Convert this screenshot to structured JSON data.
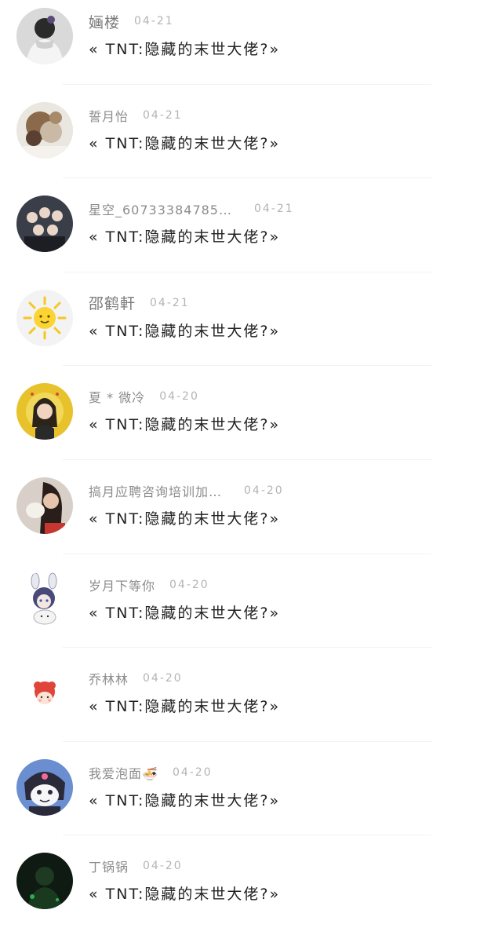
{
  "comments": [
    {
      "user": "婳楼",
      "date": "04-21",
      "text": "« TNT:隐藏的末世大佬?»",
      "avatar_icon": "user-avatar-icon"
    },
    {
      "user": "誓月怡",
      "date": "04-21",
      "text": "« TNT:隐藏的末世大佬?»",
      "avatar_icon": "user-avatar-icon"
    },
    {
      "user": "星空_60733384785…",
      "date": "04-21",
      "text": "« TNT:隐藏的末世大佬?»",
      "avatar_icon": "group-photo-avatar-icon"
    },
    {
      "user": "邵鹤軒",
      "date": "04-21",
      "text": "« TNT:隐藏的末世大佬?»",
      "avatar_icon": "sun-avatar-icon"
    },
    {
      "user": "夏 * 微冷",
      "date": "04-20",
      "text": "« TNT:隐藏的末世大佬?»",
      "avatar_icon": "user-avatar-icon"
    },
    {
      "user": "搞月应聘咨询培训加…",
      "date": "04-20",
      "text": "« TNT:隐藏的末世大佬?»",
      "avatar_icon": "user-avatar-icon"
    },
    {
      "user": "岁月下等你",
      "date": "04-20",
      "text": "« TNT:隐藏的末世大佬?»",
      "avatar_icon": "anime-bunny-avatar-icon"
    },
    {
      "user": "乔林林",
      "date": "04-20",
      "text": "« TNT:隐藏的末世大佬?»",
      "avatar_icon": "cartoon-girl-avatar-icon"
    },
    {
      "user": "我爱泡面🍜",
      "date": "04-20",
      "text": "« TNT:隐藏的末世大佬?»",
      "avatar_icon": "kuromi-avatar-icon"
    },
    {
      "user": "丁锅锅",
      "date": "04-20",
      "text": "« TNT:隐藏的末世大佬?»",
      "avatar_icon": "user-avatar-icon"
    }
  ]
}
